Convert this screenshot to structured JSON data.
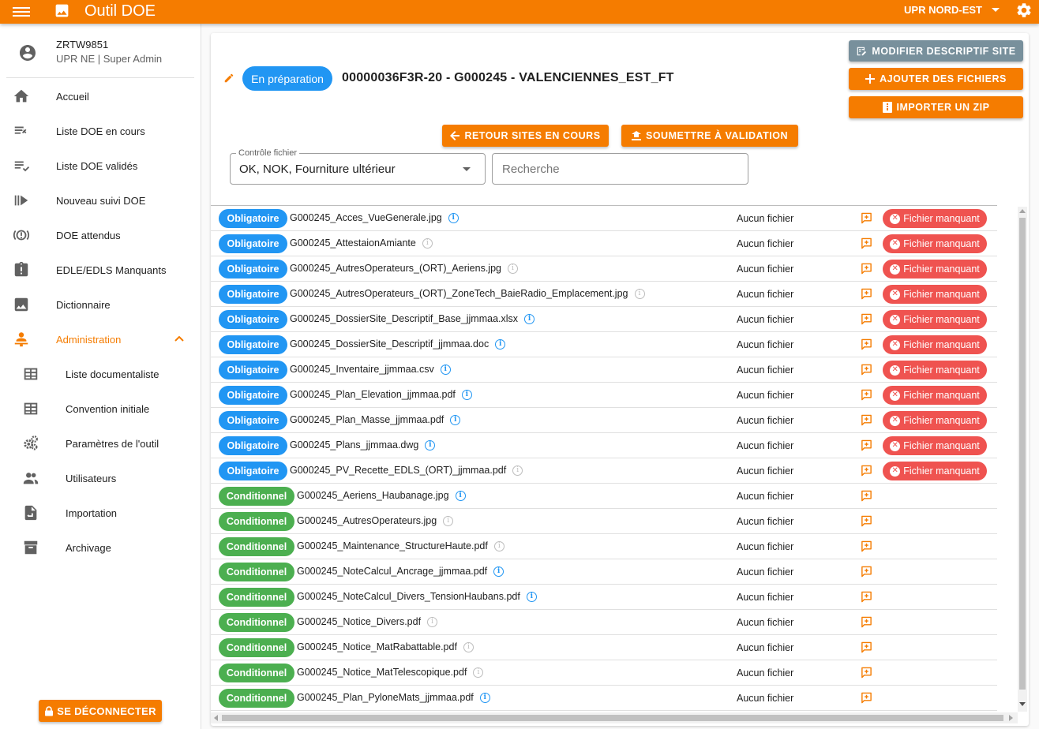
{
  "app": {
    "title": "Outil DOE",
    "region": "UPR NORD-EST"
  },
  "user": {
    "id": "ZRTW9851",
    "role": "UPR NE | Super Admin"
  },
  "nav": {
    "items": [
      {
        "label": "Accueil",
        "icon": "home-icon"
      },
      {
        "label": "Liste DOE en cours",
        "icon": "list-clear-icon"
      },
      {
        "label": "Liste DOE validés",
        "icon": "list-check-icon"
      },
      {
        "label": "Nouveau suivi DOE",
        "icon": "play-steps-icon"
      },
      {
        "label": "DOE attendus",
        "icon": "alert-circle-icon"
      },
      {
        "label": "EDLE/EDLS Manquants",
        "icon": "clipboard-alert-icon"
      },
      {
        "label": "Dictionnaire",
        "icon": "image-icon"
      },
      {
        "label": "Administration",
        "icon": "admin-person-icon"
      }
    ],
    "sub_items": [
      {
        "label": "Liste documentaliste",
        "icon": "table-icon"
      },
      {
        "label": "Convention initiale",
        "icon": "table-icon"
      },
      {
        "label": "Paramètres de l'outil",
        "icon": "gears-icon"
      },
      {
        "label": "Utilisateurs",
        "icon": "people-icon"
      },
      {
        "label": "Importation",
        "icon": "file-import-icon"
      },
      {
        "label": "Archivage",
        "icon": "archive-icon"
      }
    ],
    "logout": "SE DÉCONNECTER"
  },
  "header": {
    "status": "En préparation",
    "site_title": "00000036F3R-20 - G000245 - VALENCIENNES_EST_FT"
  },
  "actions": {
    "modify": "MODIFIER DESCRIPTIF SITE",
    "add_files": "AJOUTER DES FICHIERS",
    "import_zip": "IMPORTER UN ZIP",
    "back": "RETOUR SITES EN COURS",
    "submit": "SOUMETTRE À VALIDATION"
  },
  "filters": {
    "control_label": "Contrôle fichier",
    "control_value": "OK, NOK, Fourniture ultérieur",
    "search_placeholder": "Recherche"
  },
  "files": [
    {
      "type": "Obligatoire",
      "name": "G000245_Acces_VueGenerale.jpg",
      "info": "blue",
      "status": "Aucun fichier",
      "missing": "Fichier manquant"
    },
    {
      "type": "Obligatoire",
      "name": "G000245_AttestaionAmiante",
      "info": "grey",
      "status": "Aucun fichier",
      "missing": "Fichier manquant"
    },
    {
      "type": "Obligatoire",
      "name": "G000245_AutresOperateurs_(ORT)_Aeriens.jpg",
      "info": "grey",
      "status": "Aucun fichier",
      "missing": "Fichier manquant"
    },
    {
      "type": "Obligatoire",
      "name": "G000245_AutresOperateurs_(ORT)_ZoneTech_BaieRadio_Emplacement.jpg",
      "info": "grey",
      "status": "Aucun fichier",
      "missing": "Fichier manquant"
    },
    {
      "type": "Obligatoire",
      "name": "G000245_DossierSite_Descriptif_Base_jjmmaa.xlsx",
      "info": "blue",
      "status": "Aucun fichier",
      "missing": "Fichier manquant"
    },
    {
      "type": "Obligatoire",
      "name": "G000245_DossierSite_Descriptif_jjmmaa.doc",
      "info": "blue",
      "status": "Aucun fichier",
      "missing": "Fichier manquant"
    },
    {
      "type": "Obligatoire",
      "name": "G000245_Inventaire_jjmmaa.csv",
      "info": "blue",
      "status": "Aucun fichier",
      "missing": "Fichier manquant"
    },
    {
      "type": "Obligatoire",
      "name": "G000245_Plan_Elevation_jjmmaa.pdf",
      "info": "blue",
      "status": "Aucun fichier",
      "missing": "Fichier manquant"
    },
    {
      "type": "Obligatoire",
      "name": "G000245_Plan_Masse_jjmmaa.pdf",
      "info": "blue",
      "status": "Aucun fichier",
      "missing": "Fichier manquant"
    },
    {
      "type": "Obligatoire",
      "name": "G000245_Plans_jjmmaa.dwg",
      "info": "blue",
      "status": "Aucun fichier",
      "missing": "Fichier manquant"
    },
    {
      "type": "Obligatoire",
      "name": "G000245_PV_Recette_EDLS_(ORT)_jjmmaa.pdf",
      "info": "grey",
      "status": "Aucun fichier",
      "missing": "Fichier manquant"
    },
    {
      "type": "Conditionnel",
      "name": "G000245_Aeriens_Haubanage.jpg",
      "info": "blue",
      "status": "Aucun fichier",
      "missing": ""
    },
    {
      "type": "Conditionnel",
      "name": "G000245_AutresOperateurs.jpg",
      "info": "grey",
      "status": "Aucun fichier",
      "missing": ""
    },
    {
      "type": "Conditionnel",
      "name": "G000245_Maintenance_StructureHaute.pdf",
      "info": "grey",
      "status": "Aucun fichier",
      "missing": ""
    },
    {
      "type": "Conditionnel",
      "name": "G000245_NoteCalcul_Ancrage_jjmmaa.pdf",
      "info": "blue",
      "status": "Aucun fichier",
      "missing": ""
    },
    {
      "type": "Conditionnel",
      "name": "G000245_NoteCalcul_Divers_TensionHaubans.pdf",
      "info": "blue",
      "status": "Aucun fichier",
      "missing": ""
    },
    {
      "type": "Conditionnel",
      "name": "G000245_Notice_Divers.pdf",
      "info": "grey",
      "status": "Aucun fichier",
      "missing": ""
    },
    {
      "type": "Conditionnel",
      "name": "G000245_Notice_MatRabattable.pdf",
      "info": "grey",
      "status": "Aucun fichier",
      "missing": ""
    },
    {
      "type": "Conditionnel",
      "name": "G000245_Notice_MatTelescopique.pdf",
      "info": "grey",
      "status": "Aucun fichier",
      "missing": ""
    },
    {
      "type": "Conditionnel",
      "name": "G000245_Plan_PyloneMats_jjmmaa.pdf",
      "info": "blue",
      "status": "Aucun fichier",
      "missing": ""
    }
  ],
  "colors": {
    "primary": "#f57c00",
    "blue": "#2196f3",
    "green": "#4caf50",
    "red": "#ef5350",
    "grey_button": "#78909c"
  }
}
